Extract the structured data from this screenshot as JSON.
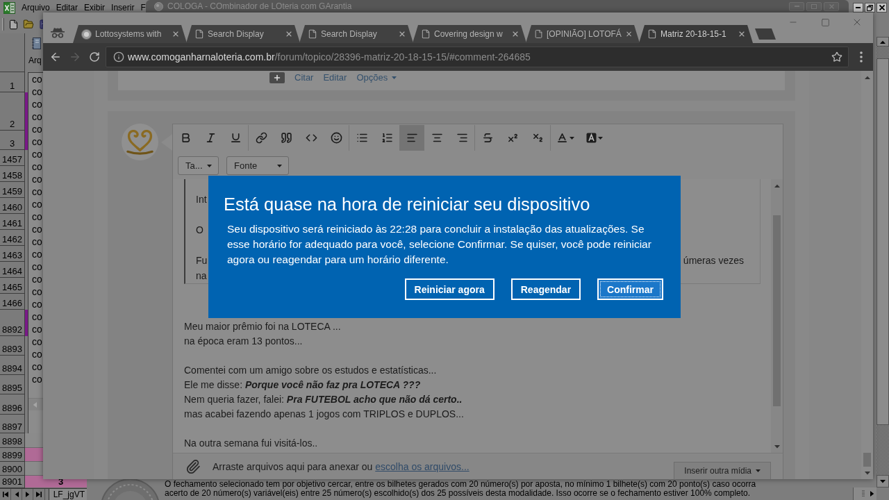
{
  "excel": {
    "menu": [
      {
        "label": "Arquivo"
      },
      {
        "label": "Editar"
      },
      {
        "label": "Exibir"
      },
      {
        "label": "Inserir"
      },
      {
        "label": "F"
      }
    ],
    "form_label": "Arq",
    "list_items": [
      "co",
      "co",
      "co",
      "co",
      "co",
      "co",
      "co",
      "co",
      "co",
      "co",
      "co",
      "co",
      "co",
      "co",
      "co",
      "co",
      "co",
      "co",
      "co",
      "co",
      "co",
      "co",
      "co",
      "co",
      "co"
    ],
    "rows": [
      {
        "number": "1"
      },
      {
        "number": "2",
        "color": "#7a1a88"
      },
      {
        "number": "3",
        "color": "#7a1a88"
      },
      {
        "number": "1457"
      },
      {
        "number": "1458"
      },
      {
        "number": "1459"
      },
      {
        "number": "1460"
      },
      {
        "number": "1461"
      },
      {
        "number": "1462"
      },
      {
        "number": "1463"
      },
      {
        "number": "1464"
      },
      {
        "number": "1465"
      },
      {
        "number": "1466"
      },
      {
        "number": "8892",
        "color": "#7a1a88"
      },
      {
        "number": "8893"
      },
      {
        "number": "8894"
      },
      {
        "number": "8895"
      },
      {
        "number": "8896"
      },
      {
        "number": "8897"
      },
      {
        "number": "8898"
      },
      {
        "number": "8899",
        "color": "#b06a96"
      },
      {
        "number": "8900"
      },
      {
        "number": "8901",
        "color": "#b06a96",
        "value": "3"
      }
    ],
    "sheet_tab": "LF_jgVT",
    "message": "O fechamento selecionado tem por objetivo cercar, entre os bilhetes gerados com 20 número(s) por aposta, no mínimo 1 bilhete(s) com 20 ponto(s) caso ocorra acerto de 20 número(s) variável(eis) entre 25 número(s) escolhido(s) dos 25 possíveis desta modalidade. Isso ocorre se o fechamento estiver 100% completo."
  },
  "cologa": {
    "title": "COLOGA - COmbinador de LOteria com GArantia"
  },
  "browser": {
    "tabs": [
      {
        "title": "Lottosystems with",
        "kind": "ball",
        "selected": false
      },
      {
        "title": "Search Display",
        "kind": "page",
        "selected": false
      },
      {
        "title": "Search Display",
        "kind": "page",
        "selected": false
      },
      {
        "title": "Covering design w",
        "kind": "page",
        "selected": false
      },
      {
        "title": "[OPINIÃO] LOTOFÁ",
        "kind": "page",
        "selected": false
      },
      {
        "title": "Matriz 20-18-15-1",
        "kind": "page",
        "selected": true
      }
    ],
    "nav": [
      {
        "kind": "back",
        "disabled": false
      },
      {
        "kind": "forward",
        "disabled": true
      },
      {
        "kind": "reload",
        "disabled": false
      }
    ],
    "url": {
      "host": "www.comoganharnaloteria.com.br",
      "path": "/forum/topico/28396-matriz-20-18-15-15/#comment-264685"
    }
  },
  "page": {
    "post_actions": [
      {
        "label": "Citar",
        "has_menu": false
      },
      {
        "label": "Editar",
        "has_menu": false
      },
      {
        "label": "Opções",
        "has_menu": true
      }
    ],
    "editor": {
      "toolbar": [
        [
          {
            "kind": "bold",
            "selected": false
          },
          {
            "kind": "italic",
            "selected": false
          },
          {
            "kind": "underline",
            "selected": false
          }
        ],
        [
          {
            "kind": "link",
            "selected": false
          },
          {
            "kind": "quote",
            "selected": false
          },
          {
            "kind": "code",
            "selected": false
          },
          {
            "kind": "emoji",
            "selected": false
          }
        ],
        [
          {
            "kind": "bullets",
            "selected": false
          },
          {
            "kind": "numbers",
            "selected": false
          },
          {
            "kind": "align-left",
            "selected": true
          },
          {
            "kind": "align-center",
            "selected": false
          },
          {
            "kind": "align-right",
            "selected": false
          }
        ],
        [
          {
            "kind": "strike",
            "selected": false
          },
          {
            "kind": "superscript",
            "selected": false
          },
          {
            "kind": "subscript",
            "selected": false
          }
        ],
        [
          {
            "kind": "text-color",
            "selected": false
          },
          {
            "kind": "background-color",
            "selected": false
          }
        ]
      ],
      "selects": [
        {
          "label": "Ta..."
        },
        {
          "label": "Fonte"
        }
      ],
      "quote": [
        [
          {
            "text": "Int"
          }
        ],
        [
          {
            "text": "O"
          }
        ],
        [
          {
            "text": "Fu",
            "tail": "úmeras vezes"
          },
          {
            "text": "na"
          }
        ]
      ],
      "body": [
        [
          "Meu maior prêmio foi na LOTECA ...",
          "na época eram 13 pontos..."
        ],
        [
          "Comentei com um amigo sobre os estudos e estatísticas...",
          "Ele me disse: **Porque você não faz pra LOTECA ???**",
          "Nem queria fazer, falei: **Pra FUTEBOL acho que não dá certo..**",
          "mas acabei fazendo apenas 1 jogos com TRIPLOS e DUPLOS..."
        ],
        [
          "Na outra semana fui visitá-los.."
        ]
      ],
      "attach": {
        "text": "Arraste arquivos aqui para anexar ou",
        "link": "escolha os arquivos..."
      },
      "media_button": "Inserir outra mídia"
    }
  },
  "dialog": {
    "title": "Está quase na hora de reiniciar seu dispositivo",
    "message": "Seu dispositivo será reiniciado às 22:28 para concluir a instalação das atualizações. Se esse horário for adequado para você, selecione Confirmar. Se quiser, você pode reiniciar agora ou reagendar para um horário diferente.",
    "buttons": [
      {
        "label": "Reiniciar agora",
        "focused": false
      },
      {
        "label": "Reagendar",
        "focused": false
      },
      {
        "label": "Confirmar",
        "focused": true
      }
    ]
  }
}
